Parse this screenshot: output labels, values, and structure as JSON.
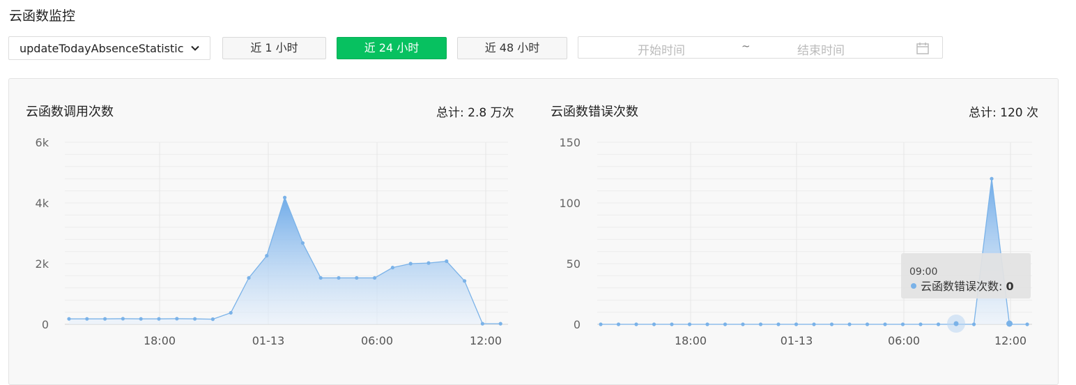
{
  "page": {
    "title": "云函数监控"
  },
  "toolbar": {
    "function_select": {
      "value": "updateTodayAbsenceStatistic"
    },
    "range_buttons": [
      {
        "label": "近 1 小时",
        "active": false
      },
      {
        "label": "近 24 小时",
        "active": true
      },
      {
        "label": "近 48 小时",
        "active": false
      }
    ],
    "date_range": {
      "start_placeholder": "开始时间",
      "separator": "~",
      "end_placeholder": "结束时间",
      "icon": "calendar-icon"
    }
  },
  "colors": {
    "accent": "#07c160",
    "series": "#7ab2e8"
  },
  "chart_data": [
    {
      "type": "area",
      "title": "云函数调用次数",
      "total_label": "总计: 2.8 万次",
      "y_ticks": [
        "0",
        "2k",
        "4k",
        "6k"
      ],
      "x_ticks": [
        "18:00",
        "01-13",
        "06:00",
        "12:00"
      ],
      "ylim": [
        0,
        6000
      ],
      "grid": true,
      "series": [
        {
          "values": [
            180,
            180,
            180,
            185,
            180,
            180,
            185,
            180,
            170,
            380,
            1530,
            2260,
            4180,
            2680,
            1530,
            1530,
            1530,
            1530,
            1870,
            2000,
            2020,
            2080,
            1430,
            20,
            20
          ]
        }
      ]
    },
    {
      "type": "area",
      "title": "云函数错误次数",
      "total_label": "总计: 120 次",
      "y_ticks": [
        "0",
        "50",
        "100",
        "150"
      ],
      "x_ticks": [
        "18:00",
        "01-13",
        "06:00",
        "12:00"
      ],
      "ylim": [
        0,
        150
      ],
      "grid": true,
      "series": [
        {
          "values": [
            0,
            0,
            0,
            0,
            0,
            0,
            0,
            0,
            0,
            0,
            0,
            0,
            0,
            0,
            0,
            0,
            0,
            0,
            0,
            0,
            0,
            0,
            120,
            0,
            0
          ]
        }
      ],
      "tooltip": {
        "time": "09:00",
        "series_name": "云函数错误次数",
        "value": "0"
      }
    }
  ]
}
